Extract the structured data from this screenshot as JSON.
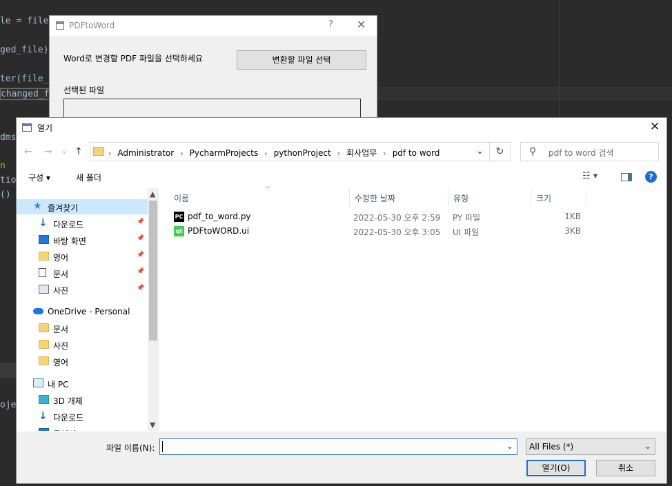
{
  "ide": {
    "code_lines": [
      "le = file_",
      "ged_file)",
      "ter(file_",
      "changed_f",
      "dms",
      "n",
      "tion",
      "()",
      "oje"
    ]
  },
  "app_window": {
    "title": "PDFtoWord",
    "help_glyph": "?",
    "close_glyph": "✕",
    "prompt": "Word로 변경할 PDF 파일을 선택하세요",
    "select_button": "변환할 파일 선택",
    "selected_label": "선택된 파일"
  },
  "dialog": {
    "title": "열기",
    "close_glyph": "✕",
    "breadcrumbs": [
      "Administrator",
      "PycharmProjects",
      "pythonProject",
      "회사업무",
      "pdf to word"
    ],
    "search_placeholder": "pdf to word 검색",
    "toolbar": {
      "organize": "구성 ▾",
      "new_folder": "새 폴더",
      "help": "?"
    },
    "nav_items": [
      {
        "label": "즐겨찾기",
        "icon": "star-icon",
        "indent": 1,
        "pinned": false,
        "selected": true
      },
      {
        "label": "다운로드",
        "icon": "download-icon",
        "indent": 2,
        "pinned": true,
        "selected": false
      },
      {
        "label": "바탕 화면",
        "icon": "desktop-icon",
        "indent": 2,
        "pinned": true,
        "selected": false
      },
      {
        "label": "영어",
        "icon": "folder-icon",
        "indent": 2,
        "pinned": true,
        "selected": false
      },
      {
        "label": "문서",
        "icon": "document-icon",
        "indent": 2,
        "pinned": true,
        "selected": false
      },
      {
        "label": "사진",
        "icon": "picture-icon",
        "indent": 2,
        "pinned": true,
        "selected": false
      },
      {
        "label": "OneDrive - Personal",
        "icon": "cloud-icon",
        "indent": 1,
        "pinned": false,
        "selected": false,
        "gap": true
      },
      {
        "label": "문서",
        "icon": "folder-icon",
        "indent": 2,
        "pinned": false,
        "selected": false
      },
      {
        "label": "사진",
        "icon": "folder-icon",
        "indent": 2,
        "pinned": false,
        "selected": false
      },
      {
        "label": "영어",
        "icon": "folder-icon",
        "indent": 2,
        "pinned": false,
        "selected": false
      },
      {
        "label": "내 PC",
        "icon": "pc-icon",
        "indent": 1,
        "pinned": false,
        "selected": false,
        "gap": true
      },
      {
        "label": "3D 개체",
        "icon": "3d-objects-icon",
        "indent": 2,
        "pinned": false,
        "selected": false
      },
      {
        "label": "다운로드",
        "icon": "download-icon",
        "indent": 2,
        "pinned": false,
        "selected": false
      },
      {
        "label": "동영상",
        "icon": "video-icon",
        "indent": 2,
        "pinned": false,
        "selected": false
      }
    ],
    "columns": [
      "이름",
      "수정한 날짜",
      "유형",
      "크기"
    ],
    "files": [
      {
        "name": "pdf_to_word.py",
        "icon": "pycharm-file-icon",
        "icon_text": "PC",
        "date": "2022-05-30 오후 2:59",
        "type": "PY 파일",
        "size": "1KB"
      },
      {
        "name": "PDFtoWORD.ui",
        "icon": "qt-ui-file-icon",
        "icon_text": "qt",
        "date": "2022-05-30 오후 3:05",
        "type": "UI 파일",
        "size": "3KB"
      }
    ],
    "filename_label": "파일 이름(N):",
    "filename_value": "",
    "filter_selected": "All Files (*)",
    "open_button": "열기(O)",
    "cancel_button": "취소"
  }
}
